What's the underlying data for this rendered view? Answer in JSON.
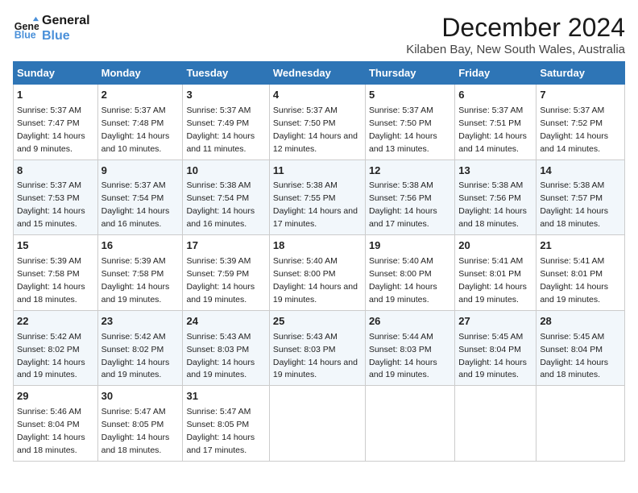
{
  "logo": {
    "line1": "General",
    "line2": "Blue"
  },
  "title": "December 2024",
  "subtitle": "Kilaben Bay, New South Wales, Australia",
  "days_of_week": [
    "Sunday",
    "Monday",
    "Tuesday",
    "Wednesday",
    "Thursday",
    "Friday",
    "Saturday"
  ],
  "weeks": [
    [
      {
        "day": 1,
        "sunrise": "5:37 AM",
        "sunset": "7:47 PM",
        "daylight": "14 hours and 9 minutes."
      },
      {
        "day": 2,
        "sunrise": "5:37 AM",
        "sunset": "7:48 PM",
        "daylight": "14 hours and 10 minutes."
      },
      {
        "day": 3,
        "sunrise": "5:37 AM",
        "sunset": "7:49 PM",
        "daylight": "14 hours and 11 minutes."
      },
      {
        "day": 4,
        "sunrise": "5:37 AM",
        "sunset": "7:50 PM",
        "daylight": "14 hours and 12 minutes."
      },
      {
        "day": 5,
        "sunrise": "5:37 AM",
        "sunset": "7:50 PM",
        "daylight": "14 hours and 13 minutes."
      },
      {
        "day": 6,
        "sunrise": "5:37 AM",
        "sunset": "7:51 PM",
        "daylight": "14 hours and 14 minutes."
      },
      {
        "day": 7,
        "sunrise": "5:37 AM",
        "sunset": "7:52 PM",
        "daylight": "14 hours and 14 minutes."
      }
    ],
    [
      {
        "day": 8,
        "sunrise": "5:37 AM",
        "sunset": "7:53 PM",
        "daylight": "14 hours and 15 minutes."
      },
      {
        "day": 9,
        "sunrise": "5:37 AM",
        "sunset": "7:54 PM",
        "daylight": "14 hours and 16 minutes."
      },
      {
        "day": 10,
        "sunrise": "5:38 AM",
        "sunset": "7:54 PM",
        "daylight": "14 hours and 16 minutes."
      },
      {
        "day": 11,
        "sunrise": "5:38 AM",
        "sunset": "7:55 PM",
        "daylight": "14 hours and 17 minutes."
      },
      {
        "day": 12,
        "sunrise": "5:38 AM",
        "sunset": "7:56 PM",
        "daylight": "14 hours and 17 minutes."
      },
      {
        "day": 13,
        "sunrise": "5:38 AM",
        "sunset": "7:56 PM",
        "daylight": "14 hours and 18 minutes."
      },
      {
        "day": 14,
        "sunrise": "5:38 AM",
        "sunset": "7:57 PM",
        "daylight": "14 hours and 18 minutes."
      }
    ],
    [
      {
        "day": 15,
        "sunrise": "5:39 AM",
        "sunset": "7:58 PM",
        "daylight": "14 hours and 18 minutes."
      },
      {
        "day": 16,
        "sunrise": "5:39 AM",
        "sunset": "7:58 PM",
        "daylight": "14 hours and 19 minutes."
      },
      {
        "day": 17,
        "sunrise": "5:39 AM",
        "sunset": "7:59 PM",
        "daylight": "14 hours and 19 minutes."
      },
      {
        "day": 18,
        "sunrise": "5:40 AM",
        "sunset": "8:00 PM",
        "daylight": "14 hours and 19 minutes."
      },
      {
        "day": 19,
        "sunrise": "5:40 AM",
        "sunset": "8:00 PM",
        "daylight": "14 hours and 19 minutes."
      },
      {
        "day": 20,
        "sunrise": "5:41 AM",
        "sunset": "8:01 PM",
        "daylight": "14 hours and 19 minutes."
      },
      {
        "day": 21,
        "sunrise": "5:41 AM",
        "sunset": "8:01 PM",
        "daylight": "14 hours and 19 minutes."
      }
    ],
    [
      {
        "day": 22,
        "sunrise": "5:42 AM",
        "sunset": "8:02 PM",
        "daylight": "14 hours and 19 minutes."
      },
      {
        "day": 23,
        "sunrise": "5:42 AM",
        "sunset": "8:02 PM",
        "daylight": "14 hours and 19 minutes."
      },
      {
        "day": 24,
        "sunrise": "5:43 AM",
        "sunset": "8:03 PM",
        "daylight": "14 hours and 19 minutes."
      },
      {
        "day": 25,
        "sunrise": "5:43 AM",
        "sunset": "8:03 PM",
        "daylight": "14 hours and 19 minutes."
      },
      {
        "day": 26,
        "sunrise": "5:44 AM",
        "sunset": "8:03 PM",
        "daylight": "14 hours and 19 minutes."
      },
      {
        "day": 27,
        "sunrise": "5:45 AM",
        "sunset": "8:04 PM",
        "daylight": "14 hours and 19 minutes."
      },
      {
        "day": 28,
        "sunrise": "5:45 AM",
        "sunset": "8:04 PM",
        "daylight": "14 hours and 18 minutes."
      }
    ],
    [
      {
        "day": 29,
        "sunrise": "5:46 AM",
        "sunset": "8:04 PM",
        "daylight": "14 hours and 18 minutes."
      },
      {
        "day": 30,
        "sunrise": "5:47 AM",
        "sunset": "8:05 PM",
        "daylight": "14 hours and 18 minutes."
      },
      {
        "day": 31,
        "sunrise": "5:47 AM",
        "sunset": "8:05 PM",
        "daylight": "14 hours and 17 minutes."
      },
      null,
      null,
      null,
      null
    ]
  ]
}
